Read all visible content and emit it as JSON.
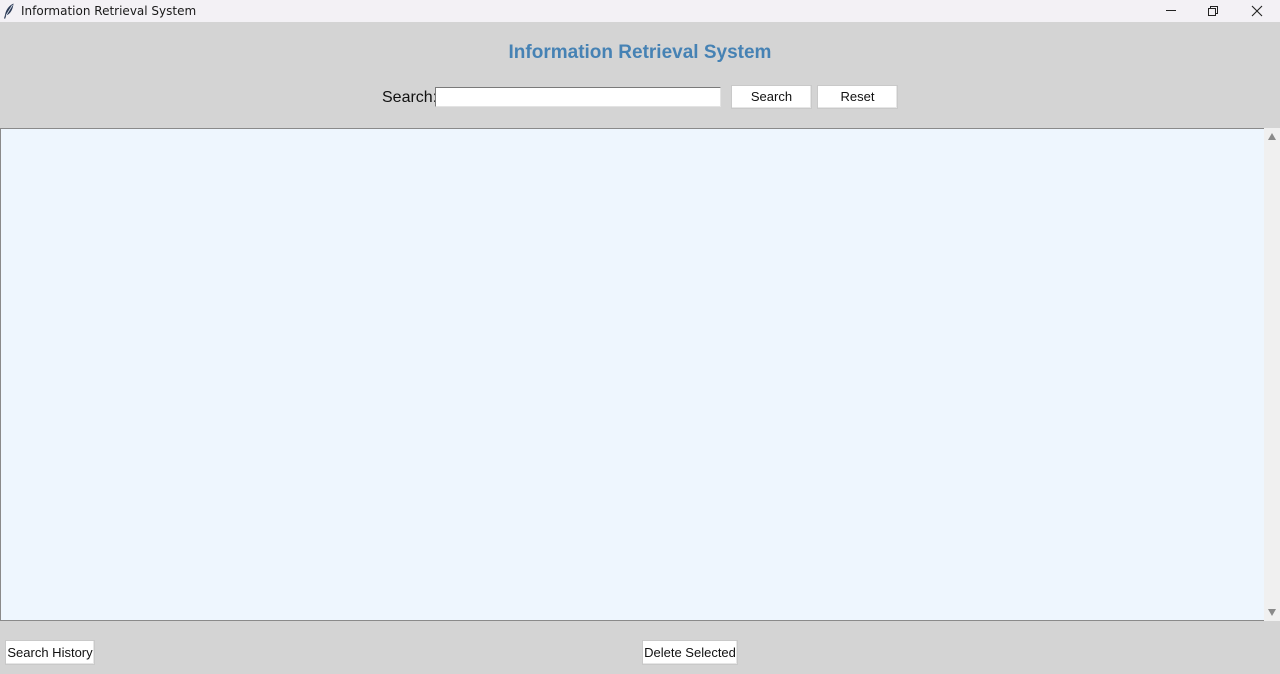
{
  "window": {
    "title": "Information Retrieval System",
    "icon": "feather-icon"
  },
  "header": {
    "heading": "Information Retrieval System",
    "heading_color": "#4682b4"
  },
  "search": {
    "label": "Search:",
    "value": "",
    "search_button": "Search",
    "reset_button": "Reset"
  },
  "results": {
    "items": [],
    "background": "#eef6fe"
  },
  "footer": {
    "history_button": "Search History",
    "delete_button": "Delete Selected"
  }
}
